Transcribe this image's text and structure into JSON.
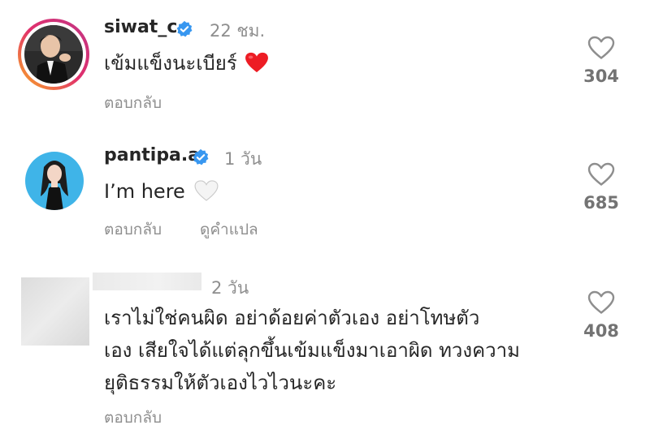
{
  "comments": [
    {
      "username": "siwat_c",
      "verified": true,
      "time": "22 ชม.",
      "text": "เข้มแข็งนะเบียร์",
      "emoji": "heart-red",
      "actions": [
        "ตอบกลับ"
      ],
      "likes": "304",
      "avatar": "photo-man-dark-suit",
      "avatar_ring": "story-gradient"
    },
    {
      "username": "pantipa.a",
      "verified": true,
      "time": "1 วัน",
      "text": "I’m here",
      "emoji": "heart-white",
      "actions": [
        "ตอบกลับ",
        "ดูคำแปล"
      ],
      "likes": "685",
      "avatar": "illustration-woman-blue-background"
    },
    {
      "username": "",
      "username_blurred": true,
      "time": "2 วัน",
      "text_lines": [
        "เราไม่ใช่คนผิด  อย่าด้อยค่าตัวเอง  อย่าโทษตัว",
        "เอง  เสียใจได้แต่ลุกขึ้นเข้มแข็งมาเอาผิด  ทวงความ",
        "ยุติธรรมให้ตัวเองไวไวนะคะ"
      ],
      "actions": [
        "ตอบกลับ"
      ],
      "likes": "408",
      "avatar": "blurred"
    }
  ],
  "colors": {
    "verified_blue": "#3897f0",
    "heart_red": "#ed4956",
    "secondary_text": "#8e8e8e",
    "primary_text": "#262626"
  }
}
